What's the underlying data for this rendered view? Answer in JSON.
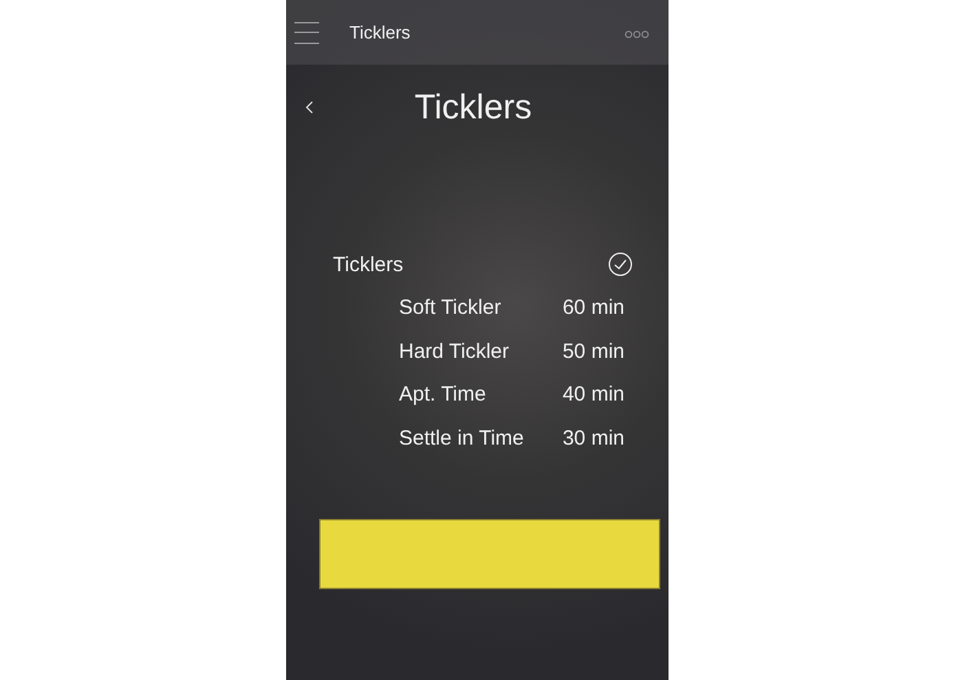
{
  "top_bar": {
    "title": "Ticklers"
  },
  "header": {
    "title": "Ticklers"
  },
  "section": {
    "title": "Ticklers",
    "checked": true,
    "rows": [
      {
        "label": "Soft Tickler",
        "value": "60 min"
      },
      {
        "label": "Hard Tickler",
        "value": "50 min"
      },
      {
        "label": "Apt. Time",
        "value": "40 min"
      },
      {
        "label": "Settle in Time",
        "value": "30 min"
      }
    ]
  }
}
